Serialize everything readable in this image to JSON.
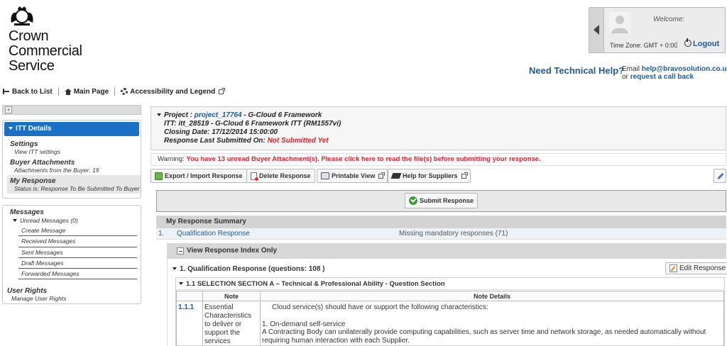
{
  "brand": {
    "line1": "Crown",
    "line2": "Commercial",
    "line3": "Service"
  },
  "user": {
    "welcome": "Welcome:",
    "timezone": "Time Zone: GMT + 0:00",
    "separator": "|",
    "logout": "Logout"
  },
  "tech_help": {
    "title": "Need Technical Help?",
    "email_prefix": "Email ",
    "email": "help@bravosolution.co.uk",
    "or": "or ",
    "callback": "request a call back"
  },
  "toolbar": {
    "back": "Back to List",
    "main_page": "Main Page",
    "accessibility": "Accessibility and Legend"
  },
  "sidebar": {
    "itt_details": "ITT Details",
    "items": [
      {
        "title": "Settings",
        "sub": "View ITT settings"
      },
      {
        "title": "Buyer Attachments",
        "sub": "Attachments from the Buyer: 19"
      },
      {
        "title": "My Response",
        "sub": "Status is: Response To Be Submitted To Buyer"
      }
    ],
    "messages": {
      "title": "Messages",
      "unread": "Unread Messages (0)",
      "list": [
        "Create Message",
        "Received Messages",
        "Sent Messages",
        "Draft Messages",
        "Forwarded Messages"
      ]
    },
    "user_rights": {
      "title": "User Rights",
      "sub": "Manage User Rights"
    }
  },
  "project": {
    "project_label": "Project : ",
    "project_link": "project_17764",
    "project_rest": " - G-Cloud 6 Framework",
    "itt": "ITT: itt_28519 - G-Cloud 6 Framework ITT (RM1557vi)",
    "closing": "Closing Date: 17/12/2014 15:00:00",
    "last_submitted_label": "Response Last Submitted On: ",
    "last_submitted_value": "Not Submitted Yet"
  },
  "warning": {
    "label": "Warning: ",
    "text": "You have 13 unread Buyer Attachment(s). Please click here to read the file(s) before submitting your response."
  },
  "actions": {
    "export": "Export / Import Response",
    "delete": "Delete Response",
    "printable": "Printable View",
    "help": "Help for Suppliers",
    "submit": "Submit Response"
  },
  "summary": {
    "title": "My Response Summary",
    "row": {
      "num": "1.",
      "name": "Qualification Response",
      "status": "Missing mandatory responses (71)"
    }
  },
  "index": {
    "toggle": "View Response Index Only",
    "qualification": "1. Qualification Response (questions: 108 )",
    "edit": "Edit Response",
    "section": "1.1  SELECTION SECTION A – Technical & Professional Ability - Question Section",
    "columns": {
      "note": "Note",
      "details": "Note Details"
    },
    "rows": [
      {
        "num": "1.1.1",
        "note": "Essential Characteristics to deliver or support the services",
        "details_1": "Cloud service(s) should have or support the following characteristics:",
        "details_2": "1. On-demand self-service",
        "details_3": "A Contracting Body can unilaterally provide computing capabilities, such as server time and network storage, as needed automatically without requiring human interaction with each Supplier."
      }
    ]
  }
}
